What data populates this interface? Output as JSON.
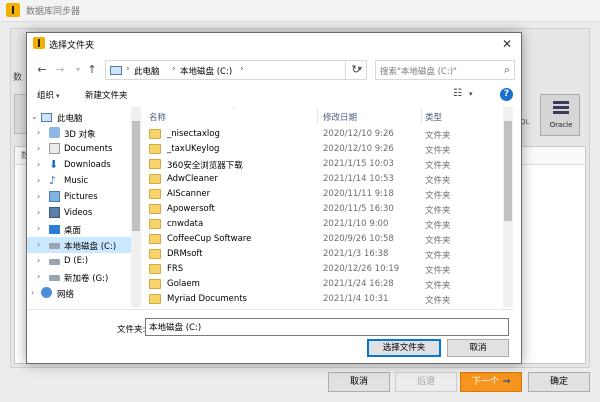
{
  "app": {
    "title": "数据库同步器"
  },
  "bg": {
    "section_label": "数",
    "list_header": "数",
    "sql_label": "QL",
    "oracle_label": "Oracle",
    "buttons": {
      "cancel": "取消",
      "back": "后退",
      "next": "下一个",
      "ok": "确定"
    }
  },
  "dialog": {
    "title": "选择文件夹",
    "close_glyph": "✕",
    "breadcrumb": [
      "此电脑",
      "本地磁盘 (C:)"
    ],
    "search_placeholder": "搜索\"本地磁盘 (C:)\"",
    "toolbar": {
      "organize": "组织",
      "new_folder": "新建文件夹"
    },
    "tree": [
      {
        "label": "此电脑",
        "icon": "pc-icon",
        "expanded": true
      },
      {
        "label": "3D 对象",
        "icon": "3d-objects-icon"
      },
      {
        "label": "Documents",
        "icon": "documents-icon"
      },
      {
        "label": "Downloads",
        "icon": "downloads-icon"
      },
      {
        "label": "Music",
        "icon": "music-icon"
      },
      {
        "label": "Pictures",
        "icon": "pictures-icon"
      },
      {
        "label": "Videos",
        "icon": "videos-icon"
      },
      {
        "label": "桌面",
        "icon": "desktop-icon"
      },
      {
        "label": "本地磁盘 (C:)",
        "icon": "drive-icon",
        "selected": true
      },
      {
        "label": "D (E:)",
        "icon": "drive-icon"
      },
      {
        "label": "新加卷 (G:)",
        "icon": "drive-icon"
      },
      {
        "label": "网络",
        "icon": "network-icon"
      }
    ],
    "columns": {
      "name": "名称",
      "date": "修改日期",
      "type": "类型"
    },
    "files": [
      {
        "name": "_nisectaxlog",
        "date": "2020/12/10 9:26",
        "type": "文件夹"
      },
      {
        "name": "_taxUKeylog",
        "date": "2020/12/10 9:26",
        "type": "文件夹"
      },
      {
        "name": "360安全浏览器下载",
        "date": "2021/1/15 10:03",
        "type": "文件夹"
      },
      {
        "name": "AdwCleaner",
        "date": "2021/1/14 10:53",
        "type": "文件夹"
      },
      {
        "name": "AIScanner",
        "date": "2020/11/11 9:18",
        "type": "文件夹"
      },
      {
        "name": "Apowersoft",
        "date": "2020/11/5 16:30",
        "type": "文件夹"
      },
      {
        "name": "cnwdata",
        "date": "2021/1/10 9:00",
        "type": "文件夹"
      },
      {
        "name": "CoffeeCup Software",
        "date": "2020/9/26 10:58",
        "type": "文件夹"
      },
      {
        "name": "DRMsoft",
        "date": "2021/1/3 16:38",
        "type": "文件夹"
      },
      {
        "name": "FRS",
        "date": "2020/12/26 10:19",
        "type": "文件夹"
      },
      {
        "name": "Golaem",
        "date": "2021/1/24 16:28",
        "type": "文件夹"
      },
      {
        "name": "Myriad Documents",
        "date": "2021/1/4 10:31",
        "type": "文件夹"
      }
    ],
    "filename_label": "文件夹:",
    "filename_value": "本地磁盘 (C:)",
    "select_button": "选择文件夹",
    "cancel_button": "取消"
  }
}
